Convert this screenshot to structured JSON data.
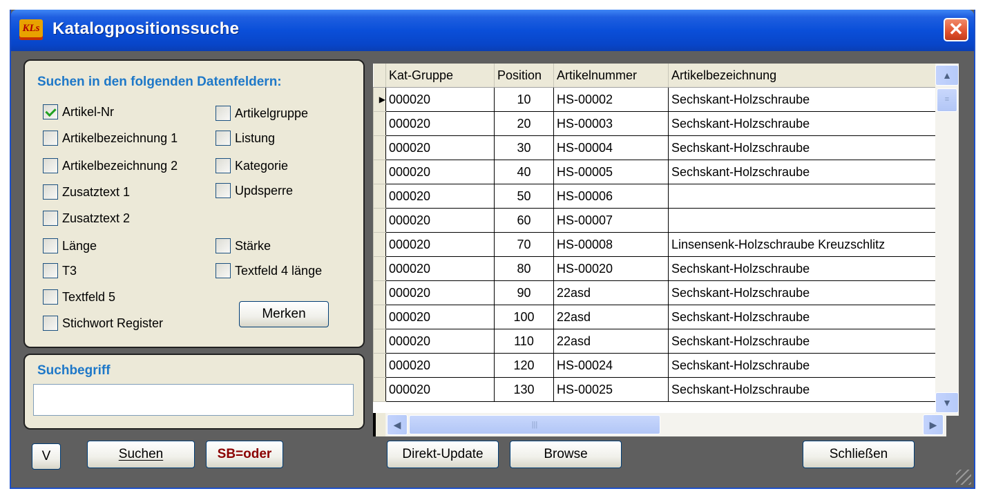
{
  "window": {
    "title": "Katalogpositionssuche",
    "logo_text": "KLs",
    "close_glyph": "✕"
  },
  "search_fields": {
    "heading": "Suchen in den folgenden Datenfeldern:",
    "left_column": [
      {
        "label": "Artikel-Nr",
        "checked": true
      },
      {
        "label": "Artikelbezeichnung 1",
        "checked": false
      },
      {
        "label": "Artikelbezeichnung 2",
        "checked": false
      },
      {
        "label": "Zusatztext 1",
        "checked": false
      },
      {
        "label": "Zusatztext 2",
        "checked": false
      },
      {
        "label": "Länge",
        "checked": false
      },
      {
        "label": "T3",
        "checked": false
      },
      {
        "label": "Textfeld 5",
        "checked": false
      },
      {
        "label": "Stichwort Register",
        "checked": false
      }
    ],
    "right_column": [
      {
        "label": "Artikelgruppe",
        "checked": false
      },
      {
        "label": "Listung",
        "checked": false
      },
      {
        "label": "Kategorie",
        "checked": false
      },
      {
        "label": "Updsperre",
        "checked": false
      },
      {
        "label": "Stärke",
        "checked": false
      },
      {
        "label": "Textfeld 4 länge",
        "checked": false
      }
    ],
    "merken_label": "Merken"
  },
  "search_term": {
    "heading": "Suchbegriff",
    "value": ""
  },
  "bottom_left": {
    "v_label": "V",
    "suchen_label": "Suchen",
    "sb_oder_label": "SB=oder"
  },
  "bottom_right": {
    "direkt_update_label": "Direkt-Update",
    "browse_label": "Browse",
    "schliessen_label": "Schließen"
  },
  "grid": {
    "columns": [
      "Kat-Gruppe",
      "Position",
      "Artikelnummer",
      "Artikelbezeichnung"
    ],
    "rows": [
      [
        "000020",
        "10",
        "HS-00002",
        "Sechskant-Holzschraube"
      ],
      [
        "000020",
        "20",
        "HS-00003",
        "Sechskant-Holzschraube"
      ],
      [
        "000020",
        "30",
        "HS-00004",
        "Sechskant-Holzschraube"
      ],
      [
        "000020",
        "40",
        "HS-00005",
        "Sechskant-Holzschraube"
      ],
      [
        "000020",
        "50",
        "HS-00006",
        ""
      ],
      [
        "000020",
        "60",
        "HS-00007",
        ""
      ],
      [
        "000020",
        "70",
        "HS-00008",
        "Linsensenk-Holzschraube Kreuzschlitz"
      ],
      [
        "000020",
        "80",
        "HS-00020",
        "Sechskant-Holzschraube"
      ],
      [
        "000020",
        "90",
        "22asd",
        "Sechskant-Holzschraube"
      ],
      [
        "000020",
        "100",
        "22asd",
        "Sechskant-Holzschraube"
      ],
      [
        "000020",
        "110",
        "22asd",
        "Sechskant-Holzschraube"
      ],
      [
        "000020",
        "120",
        "HS-00024",
        "Sechskant-Holzschraube"
      ],
      [
        "000020",
        "130",
        "HS-00025",
        "Sechskant-Holzschraube"
      ]
    ],
    "current_row_marker": "▶",
    "current_row_index": 0
  },
  "icons": {
    "scroll_up": "chevron-up-icon",
    "scroll_down": "chevron-down-icon",
    "scroll_left": "chevron-left-icon",
    "scroll_right": "chevron-right-icon",
    "resize": "resize-grip-icon"
  },
  "colors": {
    "panel_heading": "#1e78c8",
    "sb_oder": "#8b0000",
    "window_bg": "#5f5f5f",
    "title_bar": "#0a4fd9"
  }
}
